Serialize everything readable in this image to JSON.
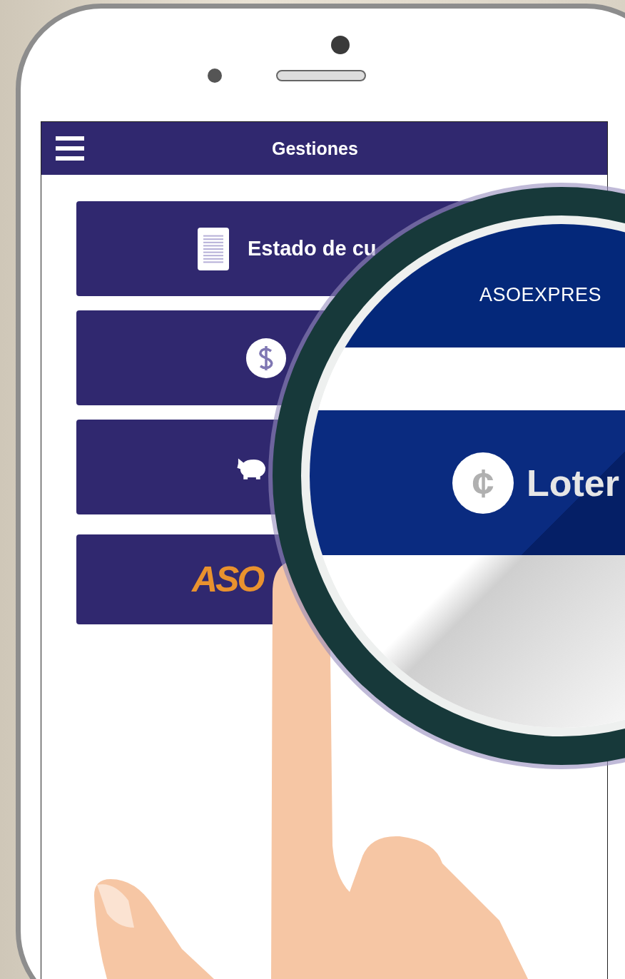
{
  "app_bar": {
    "title": "Gestiones"
  },
  "menu_buttons": [
    {
      "kind": "document",
      "label": "Estado de cu"
    },
    {
      "kind": "dollar"
    },
    {
      "kind": "piggy"
    },
    {
      "kind": "logo",
      "logo_text": "ASO"
    }
  ],
  "magnifier": {
    "header_text": "ASOEXPRES",
    "item": {
      "icon_glyph": "¢",
      "label": "Loter"
    }
  }
}
